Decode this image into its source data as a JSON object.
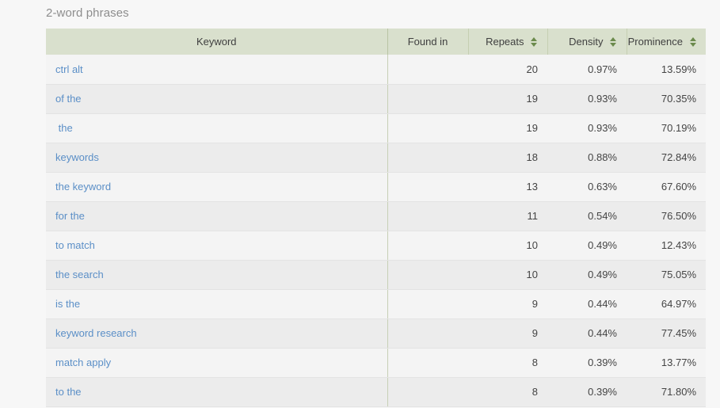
{
  "section": {
    "title": "2-word phrases"
  },
  "table": {
    "columns": [
      {
        "key": "keyword",
        "label": "Keyword",
        "sortable": false,
        "align": "center"
      },
      {
        "key": "found_in",
        "label": "Found in",
        "sortable": false,
        "align": "center"
      },
      {
        "key": "repeats",
        "label": "Repeats",
        "sortable": true,
        "align": "right"
      },
      {
        "key": "density",
        "label": "Density",
        "sortable": true,
        "align": "right"
      },
      {
        "key": "prominence",
        "label": "Prominence",
        "sortable": true,
        "align": "right"
      }
    ],
    "sort_icon_name": "sort-arrows-icon",
    "rows": [
      {
        "keyword": "ctrl alt",
        "found_in": "",
        "repeats": "20",
        "density": "0.97%",
        "prominence": "13.59%"
      },
      {
        "keyword": "of the",
        "found_in": "",
        "repeats": "19",
        "density": "0.93%",
        "prominence": "70.35%"
      },
      {
        "keyword": " the",
        "found_in": "",
        "repeats": "19",
        "density": "0.93%",
        "prominence": "70.19%"
      },
      {
        "keyword": "keywords",
        "found_in": "",
        "repeats": "18",
        "density": "0.88%",
        "prominence": "72.84%"
      },
      {
        "keyword": "the keyword",
        "found_in": "",
        "repeats": "13",
        "density": "0.63%",
        "prominence": "67.60%"
      },
      {
        "keyword": "for the",
        "found_in": "",
        "repeats": "11",
        "density": "0.54%",
        "prominence": "76.50%"
      },
      {
        "keyword": "to match",
        "found_in": "",
        "repeats": "10",
        "density": "0.49%",
        "prominence": "12.43%"
      },
      {
        "keyword": "the search",
        "found_in": "",
        "repeats": "10",
        "density": "0.49%",
        "prominence": "75.05%"
      },
      {
        "keyword": "is the",
        "found_in": "",
        "repeats": "9",
        "density": "0.44%",
        "prominence": "64.97%"
      },
      {
        "keyword": "keyword research",
        "found_in": "",
        "repeats": "9",
        "density": "0.44%",
        "prominence": "77.45%"
      },
      {
        "keyword": "match apply",
        "found_in": "",
        "repeats": "8",
        "density": "0.39%",
        "prominence": "13.77%"
      },
      {
        "keyword": "to the",
        "found_in": "",
        "repeats": "8",
        "density": "0.39%",
        "prominence": "71.80%"
      }
    ]
  },
  "colors": {
    "page_background": "#f7f7f7",
    "header_background": "#d9e0cd",
    "row_odd": "#f4f4f4",
    "row_even": "#ececec",
    "link": "#5b8fc7",
    "title_text": "#8d8d8d",
    "sort_arrow": "#6b8a4c"
  }
}
